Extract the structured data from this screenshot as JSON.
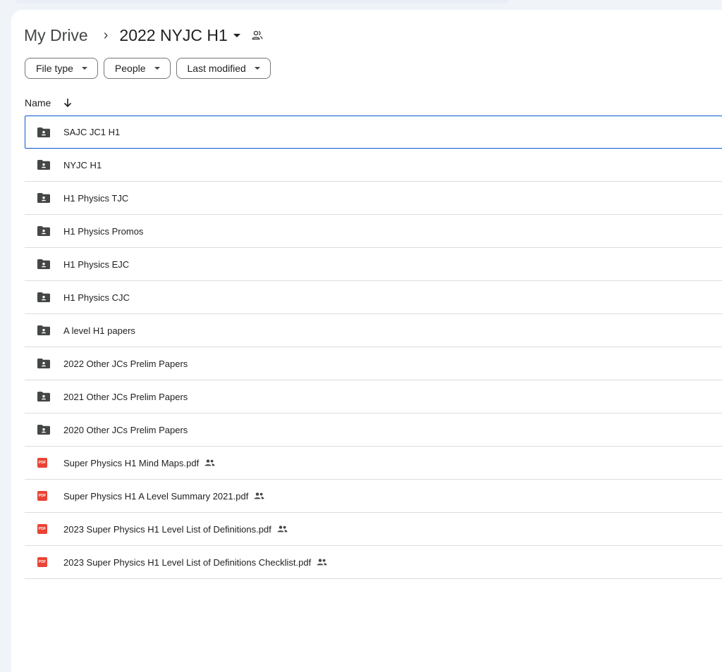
{
  "breadcrumb": {
    "root": "My Drive",
    "separator": "›",
    "current": "2022 NYJC H1"
  },
  "filters": [
    {
      "label": "File type"
    },
    {
      "label": "People"
    },
    {
      "label": "Last modified"
    }
  ],
  "list_header": {
    "name_label": "Name",
    "sort_icon": "arrow-down-icon"
  },
  "items": [
    {
      "name": "SAJC JC1 H1",
      "type": "shared-folder",
      "selected": true
    },
    {
      "name": "NYJC H1",
      "type": "shared-folder"
    },
    {
      "name": "H1 Physics TJC",
      "type": "shared-folder"
    },
    {
      "name": "H1 Physics Promos",
      "type": "shared-folder"
    },
    {
      "name": "H1 Physics EJC",
      "type": "shared-folder"
    },
    {
      "name": "H1 Physics CJC",
      "type": "shared-folder"
    },
    {
      "name": "A level H1 papers",
      "type": "shared-folder"
    },
    {
      "name": "2022 Other JCs Prelim Papers",
      "type": "shared-folder"
    },
    {
      "name": "2021 Other JCs Prelim Papers",
      "type": "shared-folder"
    },
    {
      "name": "2020 Other JCs Prelim Papers",
      "type": "shared-folder"
    },
    {
      "name": "Super Physics H1 Mind Maps.pdf",
      "type": "pdf",
      "shared": true
    },
    {
      "name": "Super Physics H1 A Level Summary 2021.pdf",
      "type": "pdf",
      "shared": true
    },
    {
      "name": "2023 Super Physics H1 Level List of Definitions.pdf",
      "type": "pdf",
      "shared": true
    },
    {
      "name": "2023 Super Physics H1 Level List of Definitions Checklist.pdf",
      "type": "pdf",
      "shared": true
    }
  ],
  "pdf_badge_text": "PDF",
  "colors": {
    "background": "#f0f4f9",
    "panel": "#ffffff",
    "selection_border": "#0b57d0",
    "pdf_red": "#ea4335",
    "folder_gray": "#444746",
    "divider": "#dadce0"
  }
}
